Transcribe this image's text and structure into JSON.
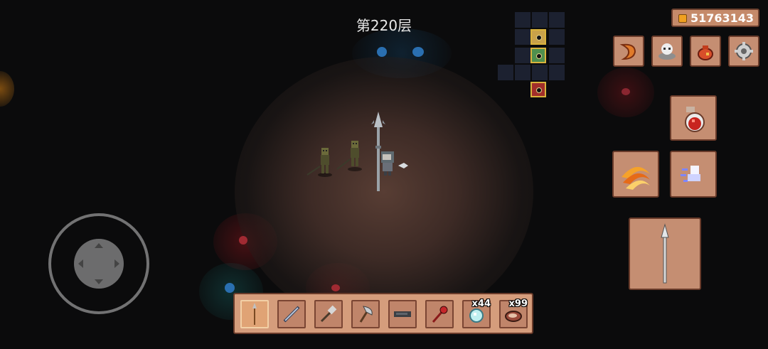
{
  "hud": {
    "floor_label": "第220层",
    "coins": "51763143"
  },
  "hotbar": {
    "slots": [
      {
        "icon": "spear-icon",
        "count": "",
        "selected": true
      },
      {
        "icon": "sword-icon",
        "count": "",
        "selected": false
      },
      {
        "icon": "syringe-staff-icon",
        "count": "",
        "selected": false
      },
      {
        "icon": "axe-icon",
        "count": "",
        "selected": false
      },
      {
        "icon": "gun-icon",
        "count": "",
        "selected": false
      },
      {
        "icon": "scepter-icon",
        "count": "",
        "selected": false
      },
      {
        "icon": "crystal-icon",
        "count": "x44",
        "selected": false
      },
      {
        "icon": "meat-icon",
        "count": "x99",
        "selected": false
      }
    ]
  },
  "equipment_buttons": [
    {
      "icon": "claw-icon"
    },
    {
      "icon": "skull-icon"
    },
    {
      "icon": "sack-icon"
    },
    {
      "icon": "settings-gear-icon"
    }
  ],
  "skills": [
    {
      "icon": "potion-icon"
    },
    {
      "icon": "fire-slash-icon"
    },
    {
      "icon": "dash-ghost-icon"
    }
  ],
  "attack_button": {
    "icon": "spear-attack-icon"
  },
  "colors": {
    "panel": "#c58e72",
    "panel_border": "#6a3b2a",
    "hotbar": "#d59d7c",
    "minimap_room": "#d9b23c",
    "background": "#0b0b0c"
  }
}
